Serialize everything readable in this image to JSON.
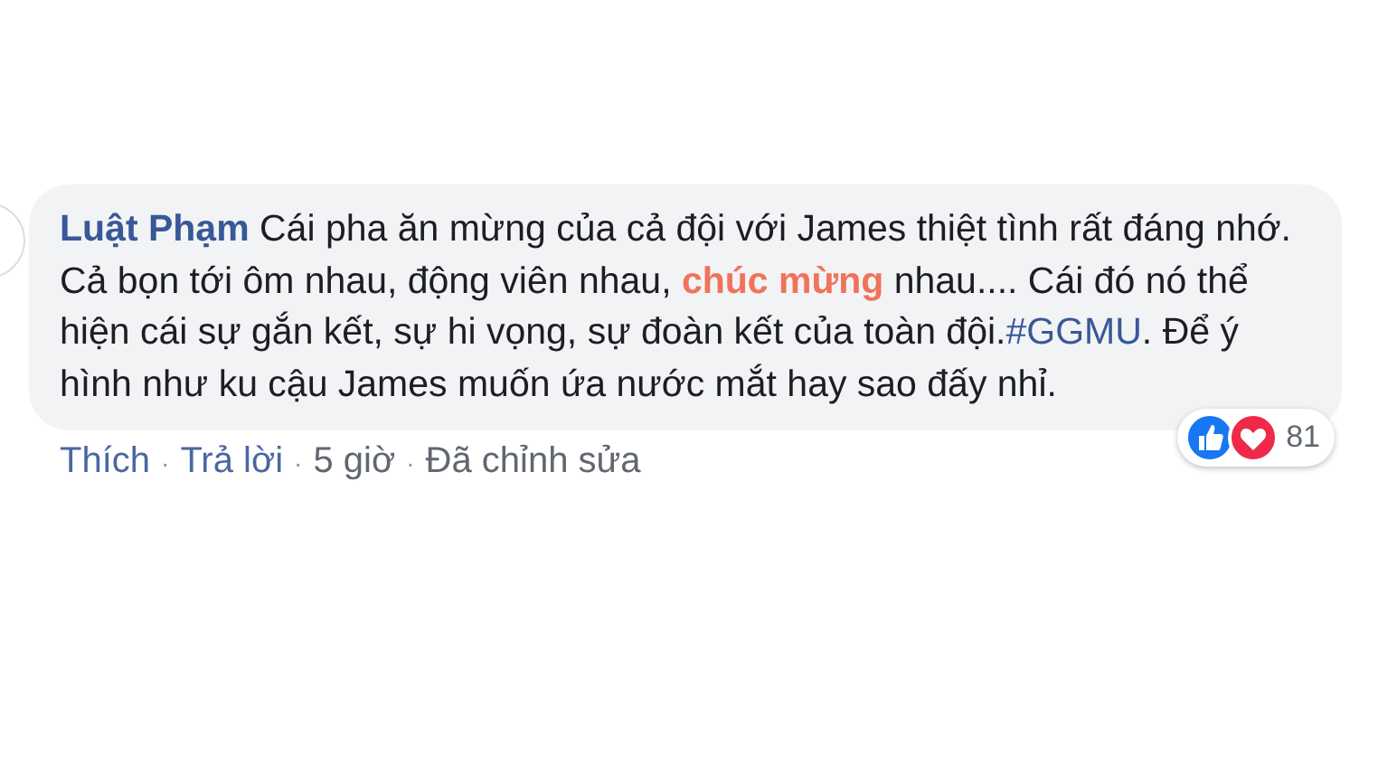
{
  "comment": {
    "author": "Luật Phạm",
    "body": [
      {
        "kind": "text",
        "text": "Cái pha ăn mừng của cả đội với James thiệt tình rất đáng nhớ. Cả bọn tới ôm nhau, động viên nhau, **chúc mừng** nhau.... Cái đó nó thể hiện cái sự gắn kết, sự hi vọng, sự đoàn kết của toàn đội."
      },
      {
        "kind": "hashtag",
        "text": "#GGMU"
      },
      {
        "kind": "text",
        "text": ". Để ý hình như ku cậu James muốn ứa nước mắt hay sao đấy nhỉ."
      }
    ],
    "reactions": {
      "count": "81"
    },
    "separator": "·",
    "actions": [
      {
        "kind": "link",
        "text": "Thích"
      },
      {
        "kind": "link",
        "text": "Trả lời"
      },
      {
        "kind": "meta",
        "text": "5 giờ"
      },
      {
        "kind": "meta",
        "text": "Đã chỉnh sửa"
      }
    ]
  }
}
